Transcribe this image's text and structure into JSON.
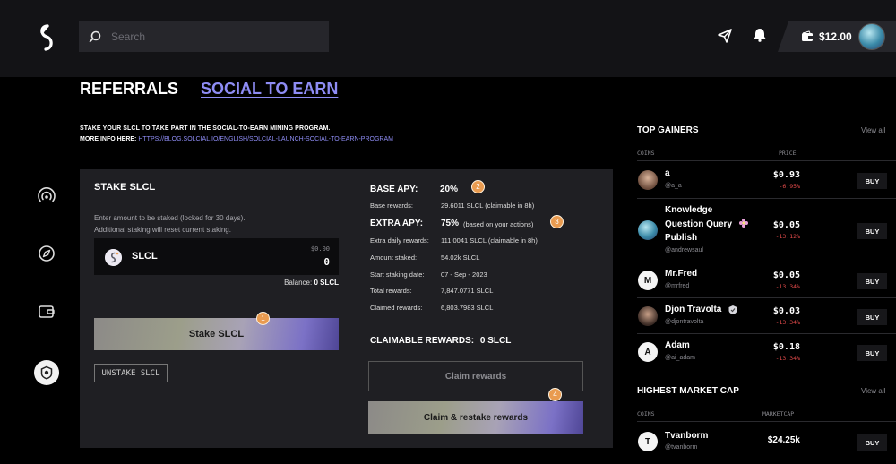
{
  "header": {
    "search_placeholder": "Search",
    "wallet_amount": "$12.00"
  },
  "tabs": {
    "referrals": "REFERRALS",
    "social_to_earn": "SOCIAL TO EARN"
  },
  "info": {
    "line1": "STAKE YOUR SLCL TO TAKE PART IN THE SOCIAL-TO-EARN MINING PROGRAM.",
    "line2_prefix": "MORE INFO HERE: ",
    "line2_link": "HTTPS://BLOG.SOLCIAL.IO/ENGLISH/SOLCIAL-LAUNCH-SOCIAL-TO-EARN-PROGRAM"
  },
  "stake": {
    "title": "STAKE SLCL",
    "desc1": "Enter amount to be staked (locked for 30 days).",
    "desc2": "Additional staking will reset current staking.",
    "coin": "SLCL",
    "usd_value": "$0.00",
    "input_value": "0",
    "balance_label": "Balance:",
    "balance_value": "0 SLCL",
    "stake_button": "Stake SLCL",
    "unstake_button": "UNSTAKE SLCL",
    "badge1": "1",
    "badge2": "2",
    "badge3": "3",
    "badge4": "4"
  },
  "apy": {
    "base_label": "BASE APY:",
    "base_value": "20%",
    "base_rewards_label": "Base rewards:",
    "base_rewards_value": "29.6011 SLCL (claimable in 8h)",
    "extra_label": "EXTRA APY:",
    "extra_value": "75%",
    "extra_note": "(based on your actions)",
    "rows": [
      {
        "label": "Extra daily rewards:",
        "value": "111.0041 SLCL (claimable in 8h)"
      },
      {
        "label": "Amount staked:",
        "value": "54.02k SLCL"
      },
      {
        "label": "Start staking date:",
        "value": "07 - Sep - 2023"
      },
      {
        "label": "Total rewards:",
        "value": "7,847.0771 SLCL"
      },
      {
        "label": "Claimed rewards:",
        "value": "6,803.7983 SLCL"
      }
    ],
    "claimable_label": "CLAIMABLE REWARDS:",
    "claimable_value": "0 SLCL",
    "claim_button": "Claim rewards",
    "restake_button": "Claim & restake rewards"
  },
  "top_gainers": {
    "title": "TOP GAINERS",
    "view_all": "View all",
    "col_coins": "COINS",
    "col_price": "PRICE",
    "buy": "BUY",
    "items": [
      {
        "name": "a",
        "handle": "@a_a",
        "price": "$0.93",
        "change": "-6.95%"
      },
      {
        "name_l1": "Knowledge",
        "name_l2": "Question Query",
        "name_l3": "Publish",
        "handle": "@andrewsaul",
        "price": "$0.05",
        "change": "-13.12%"
      },
      {
        "name": "Mr.Fred",
        "handle": "@mrfred",
        "initial": "M",
        "price": "$0.05",
        "change": "-13.34%"
      },
      {
        "name": "Djon Travolta",
        "handle": "@djontravolta",
        "price": "$0.03",
        "change": "-13.34%"
      },
      {
        "name": "Adam",
        "handle": "@ai_adam",
        "initial": "A",
        "price": "$0.18",
        "change": "-13.34%"
      }
    ]
  },
  "highest_cap": {
    "title": "HIGHEST MARKET CAP",
    "view_all": "View all",
    "col_coins": "COINS",
    "col_cap": "MARKETCAP",
    "buy": "BUY",
    "items": [
      {
        "name": "Tvanborm",
        "handle": "@tvanborm",
        "initial": "T",
        "cap": "$24.25k"
      }
    ]
  }
}
